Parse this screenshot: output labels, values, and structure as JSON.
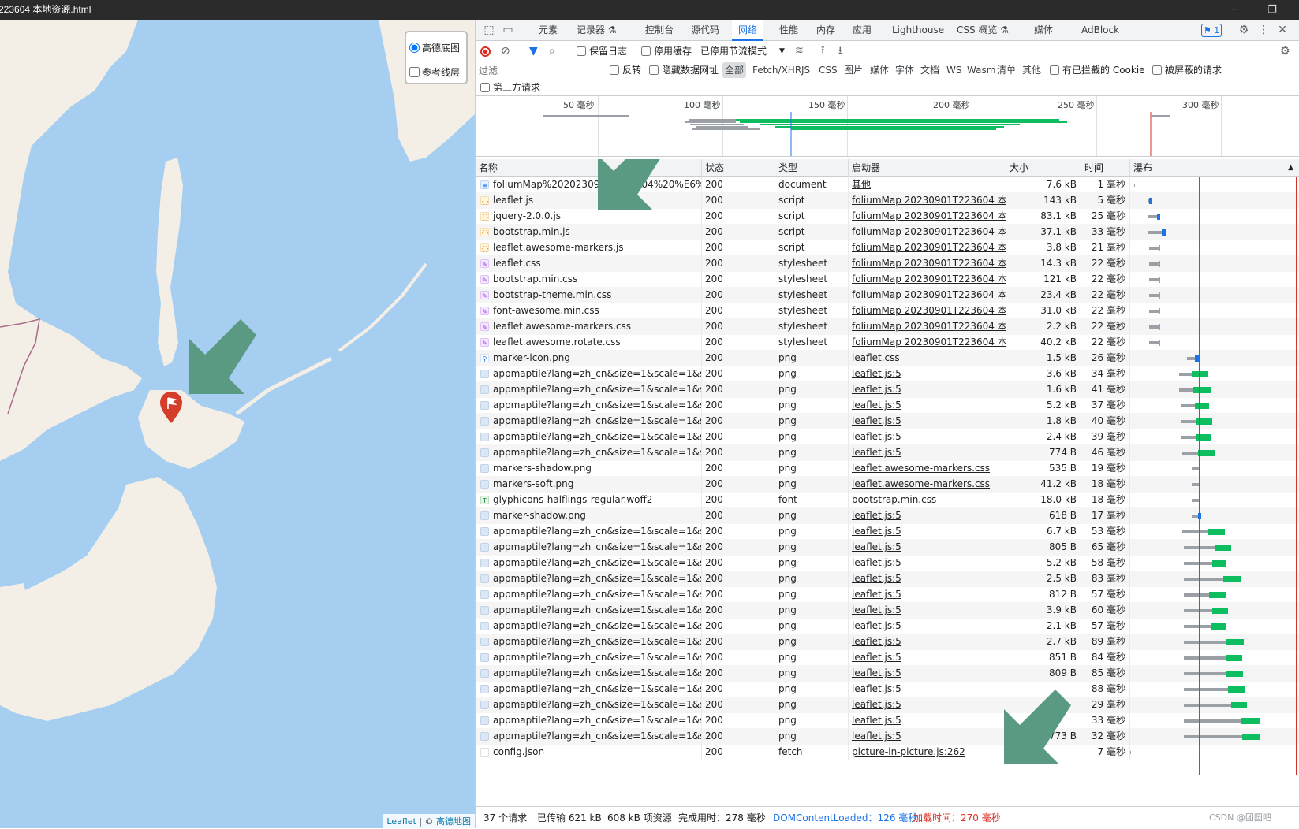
{
  "window": {
    "title": "223604 本地资源.html",
    "min": "─",
    "restore": "❐"
  },
  "map": {
    "layers": [
      {
        "label": "高德底图",
        "checked": true
      },
      {
        "label": "参考线层",
        "checked": false
      }
    ],
    "attribution": {
      "leaflet": "Leaflet",
      "sep": " | © ",
      "provider": "高德地图"
    },
    "marker_icon": "flag-icon"
  },
  "devtools": {
    "tabs": [
      "元素",
      "记录器 ⚗",
      "控制台",
      "源代码",
      "网络",
      "性能",
      "内存",
      "应用",
      "Lighthouse",
      "CSS 概览 ⚗",
      "媒体",
      "AdBlock"
    ],
    "active_tab": "网络",
    "issues_badge": "1",
    "toolbar": {
      "preserve_log": "保留日志",
      "disable_cache": "停用缓存",
      "throttle": "已停用节流模式"
    },
    "filter": {
      "placeholder": "过滤",
      "invert": "反转",
      "hide_data_urls": "隐藏数据网址",
      "types": [
        "全部",
        "Fetch/XHR",
        "JS",
        "CSS",
        "图片",
        "媒体",
        "字体",
        "文档",
        "WS",
        "Wasm",
        "清单",
        "其他"
      ],
      "blocked_cookies": "有已拦截的 Cookie",
      "blocked_requests": "被屏蔽的请求",
      "third_party": "第三方请求"
    },
    "overview_ticks": [
      "50 毫秒",
      "100 毫秒",
      "150 毫秒",
      "200 毫秒",
      "250 毫秒",
      "300 毫秒"
    ],
    "columns": {
      "name": "名称",
      "status": "状态",
      "type": "类型",
      "initiator": "启动器",
      "size": "大小",
      "time": "时间",
      "waterfall": "瀑布"
    },
    "requests": [
      {
        "name": "foliumMap%2020230901T223604%20%E6%9C...",
        "status": "200",
        "type": "document",
        "initiator": "其他",
        "size": "7.6 kB",
        "time": "1 毫秒",
        "icon": "doc"
      },
      {
        "name": "leaflet.js",
        "status": "200",
        "type": "script",
        "initiator": "foliumMap 20230901T223604 本地...",
        "size": "143 kB",
        "time": "5 毫秒",
        "icon": "js"
      },
      {
        "name": "jquery-2.0.0.js",
        "status": "200",
        "type": "script",
        "initiator": "foliumMap 20230901T223604 本地...",
        "size": "83.1 kB",
        "time": "25 毫秒",
        "icon": "js"
      },
      {
        "name": "bootstrap.min.js",
        "status": "200",
        "type": "script",
        "initiator": "foliumMap 20230901T223604 本地...",
        "size": "37.1 kB",
        "time": "33 毫秒",
        "icon": "js"
      },
      {
        "name": "leaflet.awesome-markers.js",
        "status": "200",
        "type": "script",
        "initiator": "foliumMap 20230901T223604 本地...",
        "size": "3.8 kB",
        "time": "21 毫秒",
        "icon": "js"
      },
      {
        "name": "leaflet.css",
        "status": "200",
        "type": "stylesheet",
        "initiator": "foliumMap 20230901T223604 本地...",
        "size": "14.3 kB",
        "time": "22 毫秒",
        "icon": "css"
      },
      {
        "name": "bootstrap.min.css",
        "status": "200",
        "type": "stylesheet",
        "initiator": "foliumMap 20230901T223604 本地...",
        "size": "121 kB",
        "time": "22 毫秒",
        "icon": "css"
      },
      {
        "name": "bootstrap-theme.min.css",
        "status": "200",
        "type": "stylesheet",
        "initiator": "foliumMap 20230901T223604 本地...",
        "size": "23.4 kB",
        "time": "22 毫秒",
        "icon": "css"
      },
      {
        "name": "font-awesome.min.css",
        "status": "200",
        "type": "stylesheet",
        "initiator": "foliumMap 20230901T223604 本地...",
        "size": "31.0 kB",
        "time": "22 毫秒",
        "icon": "css"
      },
      {
        "name": "leaflet.awesome-markers.css",
        "status": "200",
        "type": "stylesheet",
        "initiator": "foliumMap 20230901T223604 本地...",
        "size": "2.2 kB",
        "time": "22 毫秒",
        "icon": "css"
      },
      {
        "name": "leaflet.awesome.rotate.css",
        "status": "200",
        "type": "stylesheet",
        "initiator": "foliumMap 20230901T223604 本地...",
        "size": "40.2 kB",
        "time": "22 毫秒",
        "icon": "css"
      },
      {
        "name": "marker-icon.png",
        "status": "200",
        "type": "png",
        "initiator": "leaflet.css",
        "size": "1.5 kB",
        "time": "26 毫秒",
        "icon": "marker"
      },
      {
        "name": "appmaptile?lang=zh_cn&size=1&scale=1&styl...",
        "status": "200",
        "type": "png",
        "initiator": "leaflet.js:5",
        "size": "3.6 kB",
        "time": "34 毫秒",
        "icon": "img"
      },
      {
        "name": "appmaptile?lang=zh_cn&size=1&scale=1&styl...",
        "status": "200",
        "type": "png",
        "initiator": "leaflet.js:5",
        "size": "1.6 kB",
        "time": "41 毫秒",
        "icon": "img"
      },
      {
        "name": "appmaptile?lang=zh_cn&size=1&scale=1&styl...",
        "status": "200",
        "type": "png",
        "initiator": "leaflet.js:5",
        "size": "5.2 kB",
        "time": "37 毫秒",
        "icon": "img"
      },
      {
        "name": "appmaptile?lang=zh_cn&size=1&scale=1&styl...",
        "status": "200",
        "type": "png",
        "initiator": "leaflet.js:5",
        "size": "1.8 kB",
        "time": "40 毫秒",
        "icon": "img"
      },
      {
        "name": "appmaptile?lang=zh_cn&size=1&scale=1&styl...",
        "status": "200",
        "type": "png",
        "initiator": "leaflet.js:5",
        "size": "2.4 kB",
        "time": "39 毫秒",
        "icon": "img"
      },
      {
        "name": "appmaptile?lang=zh_cn&size=1&scale=1&styl...",
        "status": "200",
        "type": "png",
        "initiator": "leaflet.js:5",
        "size": "774 B",
        "time": "46 毫秒",
        "icon": "img"
      },
      {
        "name": "markers-shadow.png",
        "status": "200",
        "type": "png",
        "initiator": "leaflet.awesome-markers.css",
        "size": "535 B",
        "time": "19 毫秒",
        "icon": "img"
      },
      {
        "name": "markers-soft.png",
        "status": "200",
        "type": "png",
        "initiator": "leaflet.awesome-markers.css",
        "size": "41.2 kB",
        "time": "18 毫秒",
        "icon": "img"
      },
      {
        "name": "glyphicons-halflings-regular.woff2",
        "status": "200",
        "type": "font",
        "initiator": "bootstrap.min.css",
        "size": "18.0 kB",
        "time": "18 毫秒",
        "icon": "font"
      },
      {
        "name": "marker-shadow.png",
        "status": "200",
        "type": "png",
        "initiator": "leaflet.js:5",
        "size": "618 B",
        "time": "17 毫秒",
        "icon": "img"
      },
      {
        "name": "appmaptile?lang=zh_cn&size=1&scale=1&styl...",
        "status": "200",
        "type": "png",
        "initiator": "leaflet.js:5",
        "size": "6.7 kB",
        "time": "53 毫秒",
        "icon": "img"
      },
      {
        "name": "appmaptile?lang=zh_cn&size=1&scale=1&styl...",
        "status": "200",
        "type": "png",
        "initiator": "leaflet.js:5",
        "size": "805 B",
        "time": "65 毫秒",
        "icon": "img"
      },
      {
        "name": "appmaptile?lang=zh_cn&size=1&scale=1&styl...",
        "status": "200",
        "type": "png",
        "initiator": "leaflet.js:5",
        "size": "5.2 kB",
        "time": "58 毫秒",
        "icon": "img"
      },
      {
        "name": "appmaptile?lang=zh_cn&size=1&scale=1&styl...",
        "status": "200",
        "type": "png",
        "initiator": "leaflet.js:5",
        "size": "2.5 kB",
        "time": "83 毫秒",
        "icon": "img"
      },
      {
        "name": "appmaptile?lang=zh_cn&size=1&scale=1&styl...",
        "status": "200",
        "type": "png",
        "initiator": "leaflet.js:5",
        "size": "812 B",
        "time": "57 毫秒",
        "icon": "img"
      },
      {
        "name": "appmaptile?lang=zh_cn&size=1&scale=1&styl...",
        "status": "200",
        "type": "png",
        "initiator": "leaflet.js:5",
        "size": "3.9 kB",
        "time": "60 毫秒",
        "icon": "img"
      },
      {
        "name": "appmaptile?lang=zh_cn&size=1&scale=1&styl...",
        "status": "200",
        "type": "png",
        "initiator": "leaflet.js:5",
        "size": "2.1 kB",
        "time": "57 毫秒",
        "icon": "img"
      },
      {
        "name": "appmaptile?lang=zh_cn&size=1&scale=1&styl...",
        "status": "200",
        "type": "png",
        "initiator": "leaflet.js:5",
        "size": "2.7 kB",
        "time": "89 毫秒",
        "icon": "img"
      },
      {
        "name": "appmaptile?lang=zh_cn&size=1&scale=1&styl...",
        "status": "200",
        "type": "png",
        "initiator": "leaflet.js:5",
        "size": "851 B",
        "time": "84 毫秒",
        "icon": "img"
      },
      {
        "name": "appmaptile?lang=zh_cn&size=1&scale=1&styl...",
        "status": "200",
        "type": "png",
        "initiator": "leaflet.js:5",
        "size": "809 B",
        "time": "85 毫秒",
        "icon": "img"
      },
      {
        "name": "appmaptile?lang=zh_cn&size=1&scale=1&styl...",
        "status": "200",
        "type": "png",
        "initiator": "leaflet.js:5",
        "size": "",
        "time": "88 毫秒",
        "icon": "img"
      },
      {
        "name": "appmaptile?lang=zh_cn&size=1&scale=1&styl...",
        "status": "200",
        "type": "png",
        "initiator": "leaflet.js:5",
        "size": "",
        "time": "29 毫秒",
        "icon": "img"
      },
      {
        "name": "appmaptile?lang=zh_cn&size=1&scale=1&styl...",
        "status": "200",
        "type": "png",
        "initiator": "leaflet.js:5",
        "size": "",
        "time": "33 毫秒",
        "icon": "img"
      },
      {
        "name": "appmaptile?lang=zh_cn&size=1&scale=1&styl...",
        "status": "200",
        "type": "png",
        "initiator": "leaflet.js:5",
        "size": "773 B",
        "time": "32 毫秒",
        "icon": "img"
      },
      {
        "name": "config.json",
        "status": "200",
        "type": "fetch",
        "initiator": "picture-in-picture.js:262",
        "size": "",
        "time": "7 毫秒",
        "icon": "json"
      }
    ],
    "summary": {
      "requests": "37 个请求",
      "transferred": "已传输 621 kB",
      "resources": "608 kB 项资源",
      "finish": "完成用时：278 毫秒",
      "dcl": "DOMContentLoaded：126 毫秒",
      "load": "加载时间：270 毫秒"
    },
    "watermark": "CSDN @团圆吧"
  },
  "colors": {
    "accent": "#1a73e8",
    "dcl": "#1a73e8",
    "load": "#d93025",
    "waiting": "#9aa0a6",
    "download": "#0fbd61",
    "arrow": "#5b9a82",
    "land": "#f3efe7",
    "sea": "#a5cef0",
    "marker": "#d33d29"
  }
}
